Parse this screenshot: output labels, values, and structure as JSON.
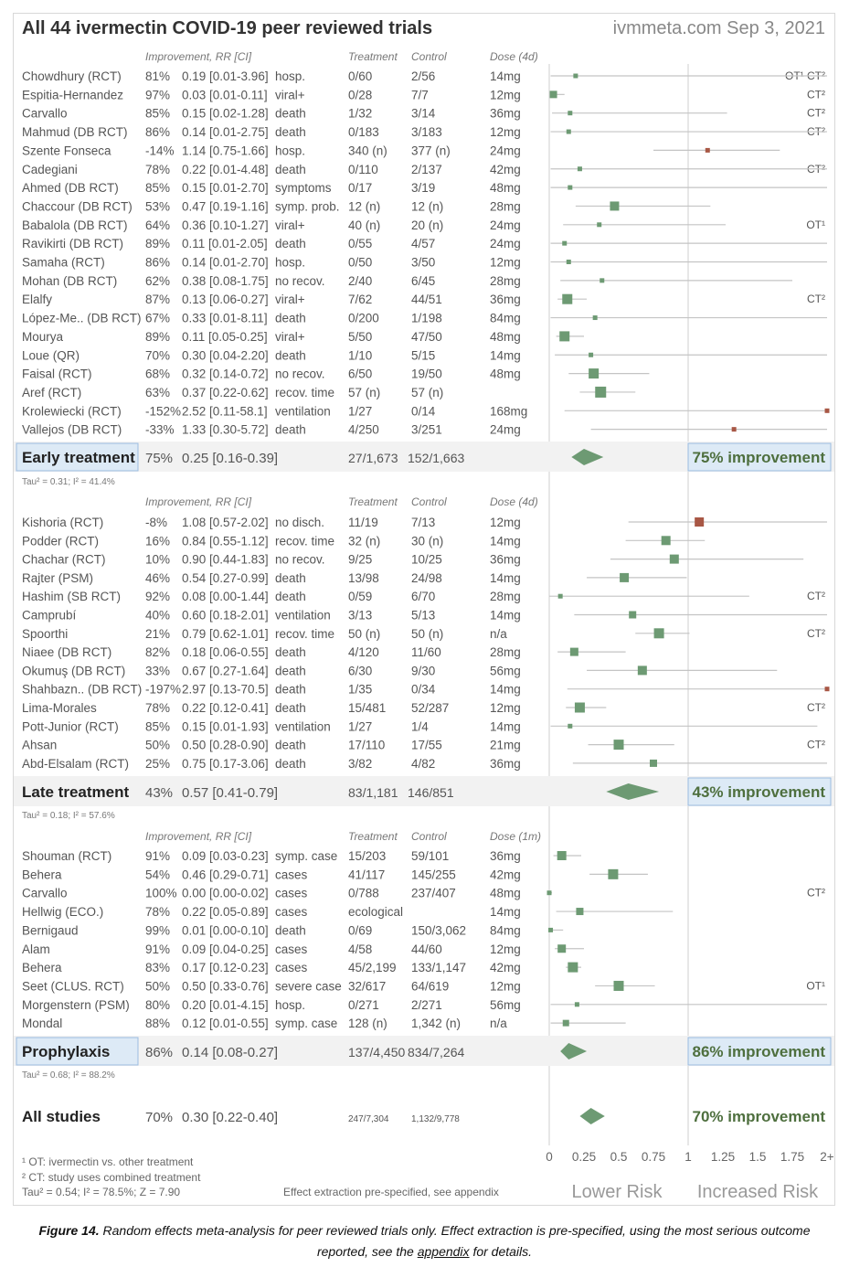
{
  "header": {
    "title": "All 44 ivermectin COVID-19 peer reviewed trials",
    "site": "ivmmeta.com Sep 3, 2021"
  },
  "colors": {
    "green": "#6d9a73",
    "red": "#a85745",
    "group_bg": "#f2f2f2",
    "box_bg": "#ddeaf6",
    "box_border": "#9cbce0",
    "text_green": "#4e6f3e"
  },
  "chart_data": {
    "type": "forest",
    "scale": {
      "ticks": [
        "0",
        "0.25",
        "0.5",
        "0.75",
        "1",
        "1.25",
        "1.5",
        "1.75",
        "2+"
      ],
      "reference_line": 1,
      "max": 2
    },
    "direction_labels": {
      "left": "Lower Risk",
      "right": "Increased Risk"
    },
    "groups": [
      {
        "name": "Early treatment",
        "headers": {
          "improvement": "Improvement, RR [CI]",
          "treatment": "Treatment",
          "control": "Control",
          "dose": "Dose (4d)"
        },
        "highlight": true,
        "studies": [
          {
            "name": "Chowdhury (RCT)",
            "imp": "81%",
            "rr_text": "0.19 [0.01-3.96]",
            "outcome": "hosp.",
            "treatment": "0/60",
            "control": "2/56",
            "dose": "14mg",
            "rr": 0.19,
            "lo": 0.01,
            "hi": 3.96,
            "notes": "OT¹ CT²"
          },
          {
            "name": "Espitia-Hernandez",
            "imp": "97%",
            "rr_text": "0.03 [0.01-0.11]",
            "outcome": "viral+",
            "treatment": "0/28",
            "control": "7/7",
            "dose": "12mg",
            "rr": 0.03,
            "lo": 0.01,
            "hi": 0.11,
            "notes": "CT²",
            "size": 8
          },
          {
            "name": "Carvallo",
            "imp": "85%",
            "rr_text": "0.15 [0.02-1.28]",
            "outcome": "death",
            "treatment": "1/32",
            "control": "3/14",
            "dose": "36mg",
            "rr": 0.15,
            "lo": 0.02,
            "hi": 1.28,
            "notes": "CT²"
          },
          {
            "name": "Mahmud (DB RCT)",
            "imp": "86%",
            "rr_text": "0.14 [0.01-2.75]",
            "outcome": "death",
            "treatment": "0/183",
            "control": "3/183",
            "dose": "12mg",
            "rr": 0.14,
            "lo": 0.01,
            "hi": 2.75,
            "notes": "CT²"
          },
          {
            "name": "Szente Fonseca",
            "imp": "-14%",
            "rr_text": "1.14 [0.75-1.66]",
            "outcome": "hosp.",
            "treatment": "340 (n)",
            "control": "377 (n)",
            "dose": "24mg",
            "rr": 1.14,
            "lo": 0.75,
            "hi": 1.66,
            "notes": "",
            "harm": true
          },
          {
            "name": "Cadegiani",
            "imp": "78%",
            "rr_text": "0.22 [0.01-4.48]",
            "outcome": "death",
            "treatment": "0/110",
            "control": "2/137",
            "dose": "42mg",
            "rr": 0.22,
            "lo": 0.01,
            "hi": 4.48,
            "notes": "CT²"
          },
          {
            "name": "Ahmed (DB RCT)",
            "imp": "85%",
            "rr_text": "0.15 [0.01-2.70]",
            "outcome": "symptoms",
            "treatment": "0/17",
            "control": "3/19",
            "dose": "48mg",
            "rr": 0.15,
            "lo": 0.01,
            "hi": 2.7,
            "notes": ""
          },
          {
            "name": "Chaccour (DB RCT)",
            "imp": "53%",
            "rr_text": "0.47 [0.19-1.16]",
            "outcome": "symp. prob.",
            "treatment": "12 (n)",
            "control": "12 (n)",
            "dose": "28mg",
            "rr": 0.47,
            "lo": 0.19,
            "hi": 1.16,
            "notes": "",
            "size": 10
          },
          {
            "name": "Babalola (DB RCT)",
            "imp": "64%",
            "rr_text": "0.36 [0.10-1.27]",
            "outcome": "viral+",
            "treatment": "40 (n)",
            "control": "20 (n)",
            "dose": "24mg",
            "rr": 0.36,
            "lo": 0.1,
            "hi": 1.27,
            "notes": "OT¹"
          },
          {
            "name": "Ravikirti (DB RCT)",
            "imp": "89%",
            "rr_text": "0.11 [0.01-2.05]",
            "outcome": "death",
            "treatment": "0/55",
            "control": "4/57",
            "dose": "24mg",
            "rr": 0.11,
            "lo": 0.01,
            "hi": 2.05,
            "notes": ""
          },
          {
            "name": "Samaha (RCT)",
            "imp": "86%",
            "rr_text": "0.14 [0.01-2.70]",
            "outcome": "hosp.",
            "treatment": "0/50",
            "control": "3/50",
            "dose": "12mg",
            "rr": 0.14,
            "lo": 0.01,
            "hi": 2.7,
            "notes": ""
          },
          {
            "name": "Mohan (DB RCT)",
            "imp": "62%",
            "rr_text": "0.38 [0.08-1.75]",
            "outcome": "no recov.",
            "treatment": "2/40",
            "control": "6/45",
            "dose": "28mg",
            "rr": 0.38,
            "lo": 0.08,
            "hi": 1.75,
            "notes": ""
          },
          {
            "name": "Elalfy",
            "imp": "87%",
            "rr_text": "0.13 [0.06-0.27]",
            "outcome": "viral+",
            "treatment": "7/62",
            "control": "44/51",
            "dose": "36mg",
            "rr": 0.13,
            "lo": 0.06,
            "hi": 0.27,
            "notes": "CT²",
            "size": 11
          },
          {
            "name": "López-Me.. (DB RCT)",
            "imp": "67%",
            "rr_text": "0.33 [0.01-8.11]",
            "outcome": "death",
            "treatment": "0/200",
            "control": "1/198",
            "dose": "84mg",
            "rr": 0.33,
            "lo": 0.01,
            "hi": 8.11,
            "notes": ""
          },
          {
            "name": "Mourya",
            "imp": "89%",
            "rr_text": "0.11 [0.05-0.25]",
            "outcome": "viral+",
            "treatment": "5/50",
            "control": "47/50",
            "dose": "48mg",
            "rr": 0.11,
            "lo": 0.05,
            "hi": 0.25,
            "notes": "",
            "size": 11
          },
          {
            "name": "Loue (QR)",
            "imp": "70%",
            "rr_text": "0.30 [0.04-2.20]",
            "outcome": "death",
            "treatment": "1/10",
            "control": "5/15",
            "dose": "14mg",
            "rr": 0.3,
            "lo": 0.04,
            "hi": 2.2,
            "notes": ""
          },
          {
            "name": "Faisal (RCT)",
            "imp": "68%",
            "rr_text": "0.32 [0.14-0.72]",
            "outcome": "no recov.",
            "treatment": "6/50",
            "control": "19/50",
            "dose": "48mg",
            "rr": 0.32,
            "lo": 0.14,
            "hi": 0.72,
            "notes": "",
            "size": 11
          },
          {
            "name": "Aref (RCT)",
            "imp": "63%",
            "rr_text": "0.37 [0.22-0.62]",
            "outcome": "recov. time",
            "treatment": "57 (n)",
            "control": "57 (n)",
            "dose": "",
            "rr": 0.37,
            "lo": 0.22,
            "hi": 0.62,
            "notes": "",
            "size": 12
          },
          {
            "name": "Krolewiecki (RCT)",
            "imp": "-152%",
            "rr_text": "2.52 [0.11-58.1]",
            "outcome": "ventilation",
            "treatment": "1/27",
            "control": "0/14",
            "dose": "168mg",
            "rr": 2.52,
            "lo": 0.11,
            "hi": 58.1,
            "notes": "",
            "harm": true
          },
          {
            "name": "Vallejos (DB RCT)",
            "imp": "-33%",
            "rr_text": "1.33 [0.30-5.72]",
            "outcome": "death",
            "treatment": "4/250",
            "control": "3/251",
            "dose": "24mg",
            "rr": 1.33,
            "lo": 0.3,
            "hi": 5.72,
            "notes": "",
            "harm": true
          }
        ],
        "summary": {
          "label": "Early treatment",
          "imp": "75%",
          "rr_text": "0.25 [0.16-0.39]",
          "treatment": "27/1,673",
          "control": "152/1,663",
          "rr": 0.25,
          "lo": 0.16,
          "hi": 0.39,
          "improvement": "75% improvement"
        },
        "tau": "Tau² = 0.31; I² = 41.4%"
      },
      {
        "name": "Late treatment",
        "headers": {
          "improvement": "Improvement, RR [CI]",
          "treatment": "Treatment",
          "control": "Control",
          "dose": "Dose (4d)"
        },
        "highlight": false,
        "studies": [
          {
            "name": "Kishoria (RCT)",
            "imp": "-8%",
            "rr_text": "1.08 [0.57-2.02]",
            "outcome": "no disch.",
            "treatment": "11/19",
            "control": "7/13",
            "dose": "12mg",
            "rr": 1.08,
            "lo": 0.57,
            "hi": 2.02,
            "notes": "",
            "harm": true,
            "size": 10
          },
          {
            "name": "Podder (RCT)",
            "imp": "16%",
            "rr_text": "0.84 [0.55-1.12]",
            "outcome": "recov. time",
            "treatment": "32 (n)",
            "control": "30 (n)",
            "dose": "14mg",
            "rr": 0.84,
            "lo": 0.55,
            "hi": 1.12,
            "notes": "",
            "size": 10
          },
          {
            "name": "Chachar (RCT)",
            "imp": "10%",
            "rr_text": "0.90 [0.44-1.83]",
            "outcome": "no recov.",
            "treatment": "9/25",
            "control": "10/25",
            "dose": "36mg",
            "rr": 0.9,
            "lo": 0.44,
            "hi": 1.83,
            "notes": "",
            "size": 10
          },
          {
            "name": "Rajter (PSM)",
            "imp": "46%",
            "rr_text": "0.54 [0.27-0.99]",
            "outcome": "death",
            "treatment": "13/98",
            "control": "24/98",
            "dose": "14mg",
            "rr": 0.54,
            "lo": 0.27,
            "hi": 0.99,
            "notes": "",
            "size": 10
          },
          {
            "name": "Hashim (SB RCT)",
            "imp": "92%",
            "rr_text": "0.08 [0.00-1.44]",
            "outcome": "death",
            "treatment": "0/59",
            "control": "6/70",
            "dose": "28mg",
            "rr": 0.08,
            "lo": 0.0,
            "hi": 1.44,
            "notes": "CT²"
          },
          {
            "name": "Camprubí",
            "imp": "40%",
            "rr_text": "0.60 [0.18-2.01]",
            "outcome": "ventilation",
            "treatment": "3/13",
            "control": "5/13",
            "dose": "14mg",
            "rr": 0.6,
            "lo": 0.18,
            "hi": 2.01,
            "notes": "",
            "size": 8
          },
          {
            "name": "Spoorthi",
            "imp": "21%",
            "rr_text": "0.79 [0.62-1.01]",
            "outcome": "recov. time",
            "treatment": "50 (n)",
            "control": "50 (n)",
            "dose": "n/a",
            "rr": 0.79,
            "lo": 0.62,
            "hi": 1.01,
            "notes": "CT²",
            "size": 11
          },
          {
            "name": "Niaee (DB RCT)",
            "imp": "82%",
            "rr_text": "0.18 [0.06-0.55]",
            "outcome": "death",
            "treatment": "4/120",
            "control": "11/60",
            "dose": "28mg",
            "rr": 0.18,
            "lo": 0.06,
            "hi": 0.55,
            "notes": "",
            "size": 9
          },
          {
            "name": "Okumuş (DB RCT)",
            "imp": "33%",
            "rr_text": "0.67 [0.27-1.64]",
            "outcome": "death",
            "treatment": "6/30",
            "control": "9/30",
            "dose": "56mg",
            "rr": 0.67,
            "lo": 0.27,
            "hi": 1.64,
            "notes": "",
            "size": 10
          },
          {
            "name": "Shahbazn.. (DB RCT)",
            "imp": "-197%",
            "rr_text": "2.97 [0.13-70.5]",
            "outcome": "death",
            "treatment": "1/35",
            "control": "0/34",
            "dose": "14mg",
            "rr": 2.97,
            "lo": 0.13,
            "hi": 70.5,
            "notes": "",
            "harm": true
          },
          {
            "name": "Lima-Morales",
            "imp": "78%",
            "rr_text": "0.22 [0.12-0.41]",
            "outcome": "death",
            "treatment": "15/481",
            "control": "52/287",
            "dose": "12mg",
            "rr": 0.22,
            "lo": 0.12,
            "hi": 0.41,
            "notes": "CT²",
            "size": 11
          },
          {
            "name": "Pott-Junior (RCT)",
            "imp": "85%",
            "rr_text": "0.15 [0.01-1.93]",
            "outcome": "ventilation",
            "treatment": "1/27",
            "control": "1/4",
            "dose": "14mg",
            "rr": 0.15,
            "lo": 0.01,
            "hi": 1.93,
            "notes": ""
          },
          {
            "name": "Ahsan",
            "imp": "50%",
            "rr_text": "0.50 [0.28-0.90]",
            "outcome": "death",
            "treatment": "17/110",
            "control": "17/55",
            "dose": "21mg",
            "rr": 0.5,
            "lo": 0.28,
            "hi": 0.9,
            "notes": "CT²",
            "size": 11
          },
          {
            "name": "Abd-Elsalam (RCT)",
            "imp": "25%",
            "rr_text": "0.75 [0.17-3.06]",
            "outcome": "death",
            "treatment": "3/82",
            "control": "4/82",
            "dose": "36mg",
            "rr": 0.75,
            "lo": 0.17,
            "hi": 3.06,
            "notes": "",
            "size": 8
          }
        ],
        "summary": {
          "label": "Late treatment",
          "imp": "43%",
          "rr_text": "0.57 [0.41-0.79]",
          "treatment": "83/1,181",
          "control": "146/851",
          "rr": 0.57,
          "lo": 0.41,
          "hi": 0.79,
          "improvement": "43% improvement"
        },
        "tau": "Tau² = 0.18; I² = 57.6%"
      },
      {
        "name": "Prophylaxis",
        "headers": {
          "improvement": "Improvement, RR [CI]",
          "treatment": "Treatment",
          "control": "Control",
          "dose": "Dose (1m)"
        },
        "highlight": true,
        "studies": [
          {
            "name": "Shouman (RCT)",
            "imp": "91%",
            "rr_text": "0.09 [0.03-0.23]",
            "outcome": "symp. case",
            "treatment": "15/203",
            "control": "59/101",
            "dose": "36mg",
            "rr": 0.09,
            "lo": 0.03,
            "hi": 0.23,
            "notes": "",
            "size": 10
          },
          {
            "name": "Behera",
            "imp": "54%",
            "rr_text": "0.46 [0.29-0.71]",
            "outcome": "cases",
            "treatment": "41/117",
            "control": "145/255",
            "dose": "42mg",
            "rr": 0.46,
            "lo": 0.29,
            "hi": 0.71,
            "notes": "",
            "size": 11
          },
          {
            "name": "Carvallo",
            "imp": "100%",
            "rr_text": "0.00 [0.00-0.02]",
            "outcome": "cases",
            "treatment": "0/788",
            "control": "237/407",
            "dose": "48mg",
            "rr": 0.0,
            "lo": 0.0,
            "hi": 0.02,
            "notes": "CT²"
          },
          {
            "name": "Hellwig (ECO.)",
            "imp": "78%",
            "rr_text": "0.22 [0.05-0.89]",
            "outcome": "cases",
            "treatment": "ecological",
            "control": "",
            "dose": "14mg",
            "rr": 0.22,
            "lo": 0.05,
            "hi": 0.89,
            "notes": "",
            "size": 8
          },
          {
            "name": "Bernigaud",
            "imp": "99%",
            "rr_text": "0.01 [0.00-0.10]",
            "outcome": "death",
            "treatment": "0/69",
            "control": "150/3,062",
            "dose": "84mg",
            "rr": 0.01,
            "lo": 0.0,
            "hi": 0.1,
            "notes": ""
          },
          {
            "name": "Alam",
            "imp": "91%",
            "rr_text": "0.09 [0.04-0.25]",
            "outcome": "cases",
            "treatment": "4/58",
            "control": "44/60",
            "dose": "12mg",
            "rr": 0.09,
            "lo": 0.04,
            "hi": 0.25,
            "notes": "",
            "size": 9
          },
          {
            "name": "Behera",
            "imp": "83%",
            "rr_text": "0.17 [0.12-0.23]",
            "outcome": "cases",
            "treatment": "45/2,199",
            "control": "133/1,147",
            "dose": "42mg",
            "rr": 0.17,
            "lo": 0.12,
            "hi": 0.23,
            "notes": "",
            "size": 11
          },
          {
            "name": "Seet (CLUS. RCT)",
            "imp": "50%",
            "rr_text": "0.50 [0.33-0.76]",
            "outcome": "severe case",
            "treatment": "32/617",
            "control": "64/619",
            "dose": "12mg",
            "rr": 0.5,
            "lo": 0.33,
            "hi": 0.76,
            "notes": "OT¹",
            "size": 11
          },
          {
            "name": "Morgenstern (PSM)",
            "imp": "80%",
            "rr_text": "0.20 [0.01-4.15]",
            "outcome": "hosp.",
            "treatment": "0/271",
            "control": "2/271",
            "dose": "56mg",
            "rr": 0.2,
            "lo": 0.01,
            "hi": 4.15,
            "notes": ""
          },
          {
            "name": "Mondal",
            "imp": "88%",
            "rr_text": "0.12 [0.01-0.55]",
            "outcome": "symp. case",
            "treatment": "128 (n)",
            "control": "1,342 (n)",
            "dose": "n/a",
            "rr": 0.12,
            "lo": 0.01,
            "hi": 0.55,
            "notes": "",
            "size": 7
          }
        ],
        "summary": {
          "label": "Prophylaxis",
          "imp": "86%",
          "rr_text": "0.14 [0.08-0.27]",
          "treatment": "137/4,450",
          "control": "834/7,264",
          "rr": 0.14,
          "lo": 0.08,
          "hi": 0.27,
          "improvement": "86% improvement"
        },
        "tau": "Tau² = 0.68; I² = 88.2%"
      }
    ],
    "overall": {
      "label": "All studies",
      "imp": "70%",
      "rr_text": "0.30 [0.22-0.40]",
      "treatment": "247/7,304",
      "control": "1,132/9,778",
      "rr": 0.3,
      "lo": 0.22,
      "hi": 0.4,
      "improvement": "70% improvement"
    },
    "footnotes": [
      "¹ OT: ivermectin vs. other treatment",
      "² CT: study uses combined treatment",
      "Tau² = 0.54; I² = 78.5%; Z = 7.90"
    ],
    "extraction_note": "Effect extraction pre-specified, see appendix"
  },
  "caption": {
    "label": "Figure 14.",
    "text_before": "Random effects meta-analysis for peer reviewed trials only. Effect extraction is pre-specified, using the most serious outcome reported, see the",
    "link": "appendix",
    "text_after": "for details."
  }
}
